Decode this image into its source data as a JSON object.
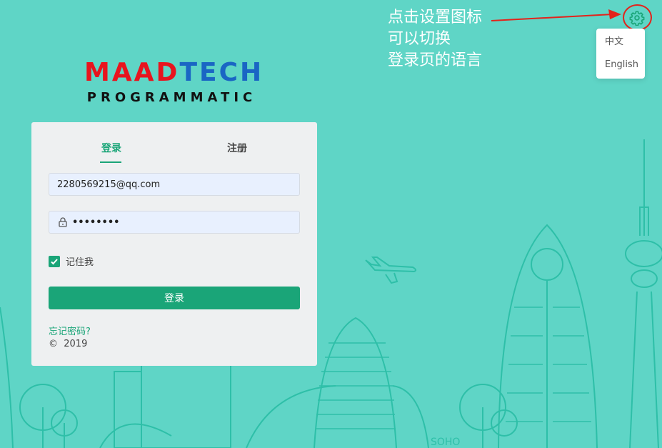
{
  "logo": {
    "part1": "MAAD",
    "part2": "TECH",
    "subtitle": "PROGRAMMATIC"
  },
  "annotation": {
    "lines": [
      "点击设置图标",
      "可以切换",
      "登录页的语言"
    ]
  },
  "language_menu": {
    "items": [
      "中文",
      "English"
    ]
  },
  "form": {
    "tabs": {
      "login": "登录",
      "register": "注册"
    },
    "email_value": "2280569215@qq.com",
    "password_mask": "••••••••",
    "remember_label": "记住我",
    "login_button": "登录",
    "forgot_link": "忘记密码?",
    "copyright_symbol": "©",
    "copyright_year": "2019"
  },
  "background": {
    "sign_text": "SOHO"
  },
  "colors": {
    "background": "#5fd5c6",
    "accent": "#1aa578",
    "logo_red": "#e8141e",
    "logo_blue": "#1a66c4",
    "annotation_red": "#e3231b"
  },
  "icons": {
    "settings": "gear-icon",
    "password": "lock-icon",
    "checkbox": "check-icon"
  }
}
